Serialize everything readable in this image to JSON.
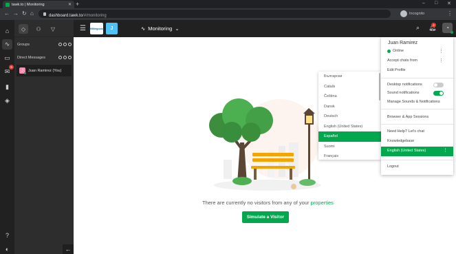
{
  "browser": {
    "tab_title": "tawk.to | Monitoring",
    "url_host": "dashboard.tawk.to",
    "url_path": "/#/monitoring",
    "profile_label": "Incognito"
  },
  "rail": {
    "inbox_badge": "9"
  },
  "panel": {
    "groups_label": "Groups",
    "dm_label": "Direct Messages",
    "dm_user_initial": "J",
    "dm_user_name": "Juan Ramirez (You)"
  },
  "topbar": {
    "property_logo_text": "MiNegocio",
    "property_initial": "J",
    "view_title": "Monitoring",
    "notif_count": "4"
  },
  "main": {
    "empty_text": "There are currently no visitors from any of your",
    "empty_link": "properties",
    "simulate_label": "Simulate a Visitor"
  },
  "languages": {
    "items": [
      "Български",
      "Català",
      "Čeština",
      "Dansk",
      "Deutsch",
      "English (United States)",
      "Español",
      "Suomi",
      "Français"
    ],
    "selected": "Español"
  },
  "user_menu": {
    "name": "Juan Ramirez",
    "status": "Online",
    "accept_chats": "Accept chats from",
    "edit_profile": "Edit Profile",
    "desktop_notifications": "Desktop notifications",
    "desktop_on": false,
    "sound_notifications": "Sound notifications",
    "sound_on": true,
    "manage_sounds": "Manage Sounds & Notifications",
    "browser_sessions": "Browser & App Sessions",
    "need_help": "Need Help? Let's chat",
    "knowledgebase": "Knowledgebase",
    "language": "English (United States)",
    "logout": "Logout"
  },
  "colors": {
    "accent": "#03a84e",
    "sidebar": "#212121",
    "panel": "#2d2d2d"
  }
}
